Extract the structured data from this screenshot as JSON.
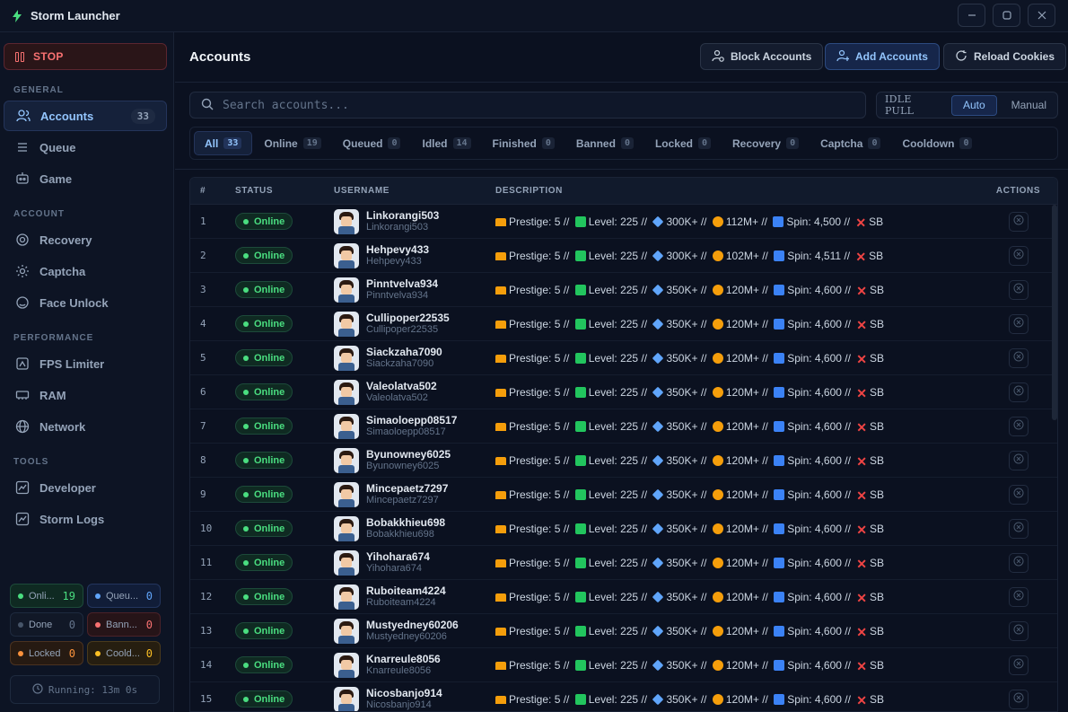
{
  "app": {
    "title": "Storm Launcher"
  },
  "sidebar": {
    "stop_label": "STOP",
    "sections": {
      "general": "GENERAL",
      "account": "ACCOUNT",
      "performance": "PERFORMANCE",
      "tools": "TOOLS"
    },
    "items": [
      {
        "label": "Accounts",
        "icon": "users-icon",
        "count": "33",
        "active": true
      },
      {
        "label": "Queue",
        "icon": "queue-icon"
      },
      {
        "label": "Game",
        "icon": "gamepad-icon"
      },
      {
        "label": "Recovery",
        "icon": "recovery-icon"
      },
      {
        "label": "Captcha",
        "icon": "gear-icon"
      },
      {
        "label": "Face Unlock",
        "icon": "face-icon"
      },
      {
        "label": "FPS Limiter",
        "icon": "gauge-icon"
      },
      {
        "label": "RAM",
        "icon": "memory-icon"
      },
      {
        "label": "Network",
        "icon": "globe-icon"
      },
      {
        "label": "Developer",
        "icon": "chart-icon"
      },
      {
        "label": "Storm Logs",
        "icon": "chart-icon"
      }
    ],
    "stats": [
      {
        "label": "Onli...",
        "value": "19",
        "color": "#4ade80"
      },
      {
        "label": "Queu...",
        "value": "0",
        "color": "#60a5fa"
      },
      {
        "label": "Done",
        "value": "0",
        "color": "#64748b"
      },
      {
        "label": "Bann...",
        "value": "0",
        "color": "#f87171"
      },
      {
        "label": "Locked",
        "value": "0",
        "color": "#fb923c"
      },
      {
        "label": "Coold...",
        "value": "0",
        "color": "#fbbf24"
      }
    ],
    "running": "Running: 13m 0s"
  },
  "header": {
    "title": "Accounts",
    "buttons": {
      "block": "Block Accounts",
      "add": "Add Accounts",
      "reload": "Reload Cookies"
    }
  },
  "search": {
    "placeholder": "Search accounts..."
  },
  "idle_pull": {
    "label": "IDLE PULL",
    "options": [
      "Auto",
      "Manual"
    ],
    "selected": "Auto"
  },
  "tabs": [
    {
      "label": "All",
      "count": "33"
    },
    {
      "label": "Online",
      "count": "19"
    },
    {
      "label": "Queued",
      "count": "0"
    },
    {
      "label": "Idled",
      "count": "14"
    },
    {
      "label": "Finished",
      "count": "0"
    },
    {
      "label": "Banned",
      "count": "0"
    },
    {
      "label": "Locked",
      "count": "0"
    },
    {
      "label": "Recovery",
      "count": "0"
    },
    {
      "label": "Captcha",
      "count": "0"
    },
    {
      "label": "Cooldown",
      "count": "0"
    }
  ],
  "table": {
    "columns": [
      "#",
      "STATUS",
      "USERNAME",
      "DESCRIPTION",
      "ACTIONS"
    ],
    "rows": [
      {
        "n": "1",
        "status": "Online",
        "name": "Linkorangi503",
        "sub": "Linkorangi503",
        "prestige": "Prestige: 5 //",
        "level": "Level: 225 //",
        "gems": "300K+ //",
        "coins": "112M+ //",
        "spin": "Spin: 4,500 //",
        "sb": "SB"
      },
      {
        "n": "2",
        "status": "Online",
        "name": "Hehpevy433",
        "sub": "Hehpevy433",
        "prestige": "Prestige: 5 //",
        "level": "Level: 225 //",
        "gems": "300K+ //",
        "coins": "102M+ //",
        "spin": "Spin: 4,511 //",
        "sb": "SB"
      },
      {
        "n": "3",
        "status": "Online",
        "name": "Pinntvelva934",
        "sub": "Pinntvelva934",
        "prestige": "Prestige: 5 //",
        "level": "Level: 225 //",
        "gems": "350K+ //",
        "coins": "120M+ //",
        "spin": "Spin: 4,600 //",
        "sb": "SB"
      },
      {
        "n": "4",
        "status": "Online",
        "name": "Cullipoper22535",
        "sub": "Cullipoper22535",
        "prestige": "Prestige: 5 //",
        "level": "Level: 225 //",
        "gems": "350K+ //",
        "coins": "120M+ //",
        "spin": "Spin: 4,600 //",
        "sb": "SB"
      },
      {
        "n": "5",
        "status": "Online",
        "name": "Siackzaha7090",
        "sub": "Siackzaha7090",
        "prestige": "Prestige: 5 //",
        "level": "Level: 225 //",
        "gems": "350K+ //",
        "coins": "120M+ //",
        "spin": "Spin: 4,600 //",
        "sb": "SB"
      },
      {
        "n": "6",
        "status": "Online",
        "name": "Valeolatva502",
        "sub": "Valeolatva502",
        "prestige": "Prestige: 5 //",
        "level": "Level: 225 //",
        "gems": "350K+ //",
        "coins": "120M+ //",
        "spin": "Spin: 4,600 //",
        "sb": "SB"
      },
      {
        "n": "7",
        "status": "Online",
        "name": "Simaoloepp08517",
        "sub": "Simaoloepp08517",
        "prestige": "Prestige: 5 //",
        "level": "Level: 225 //",
        "gems": "350K+ //",
        "coins": "120M+ //",
        "spin": "Spin: 4,600 //",
        "sb": "SB"
      },
      {
        "n": "8",
        "status": "Online",
        "name": "Byunowney6025",
        "sub": "Byunowney6025",
        "prestige": "Prestige: 5 //",
        "level": "Level: 225 //",
        "gems": "350K+ //",
        "coins": "120M+ //",
        "spin": "Spin: 4,600 //",
        "sb": "SB"
      },
      {
        "n": "9",
        "status": "Online",
        "name": "Mincepaetz7297",
        "sub": "Mincepaetz7297",
        "prestige": "Prestige: 5 //",
        "level": "Level: 225 //",
        "gems": "350K+ //",
        "coins": "120M+ //",
        "spin": "Spin: 4,600 //",
        "sb": "SB"
      },
      {
        "n": "10",
        "status": "Online",
        "name": "Bobakkhieu698",
        "sub": "Bobakkhieu698",
        "prestige": "Prestige: 5 //",
        "level": "Level: 225 //",
        "gems": "350K+ //",
        "coins": "120M+ //",
        "spin": "Spin: 4,600 //",
        "sb": "SB"
      },
      {
        "n": "11",
        "status": "Online",
        "name": "Yihohara674",
        "sub": "Yihohara674",
        "prestige": "Prestige: 5 //",
        "level": "Level: 225 //",
        "gems": "350K+ //",
        "coins": "120M+ //",
        "spin": "Spin: 4,600 //",
        "sb": "SB"
      },
      {
        "n": "12",
        "status": "Online",
        "name": "Ruboiteam4224",
        "sub": "Ruboiteam4224",
        "prestige": "Prestige: 5 //",
        "level": "Level: 225 //",
        "gems": "350K+ //",
        "coins": "120M+ //",
        "spin": "Spin: 4,600 //",
        "sb": "SB"
      },
      {
        "n": "13",
        "status": "Online",
        "name": "Mustyedney60206",
        "sub": "Mustyedney60206",
        "prestige": "Prestige: 5 //",
        "level": "Level: 225 //",
        "gems": "350K+ //",
        "coins": "120M+ //",
        "spin": "Spin: 4,600 //",
        "sb": "SB"
      },
      {
        "n": "14",
        "status": "Online",
        "name": "Knarreule8056",
        "sub": "Knarreule8056",
        "prestige": "Prestige: 5 //",
        "level": "Level: 225 //",
        "gems": "350K+ //",
        "coins": "120M+ //",
        "spin": "Spin: 4,600 //",
        "sb": "SB"
      },
      {
        "n": "15",
        "status": "Online",
        "name": "Nicosbanjo914",
        "sub": "Nicosbanjo914",
        "prestige": "Prestige: 5 //",
        "level": "Level: 225 //",
        "gems": "350K+ //",
        "coins": "120M+ //",
        "spin": "Spin: 4,600 //",
        "sb": "SB"
      }
    ]
  },
  "colors": {
    "accent": "#93c5fd",
    "online": "#4ade80",
    "stop": "#f87171",
    "bg": "#0b1120"
  }
}
